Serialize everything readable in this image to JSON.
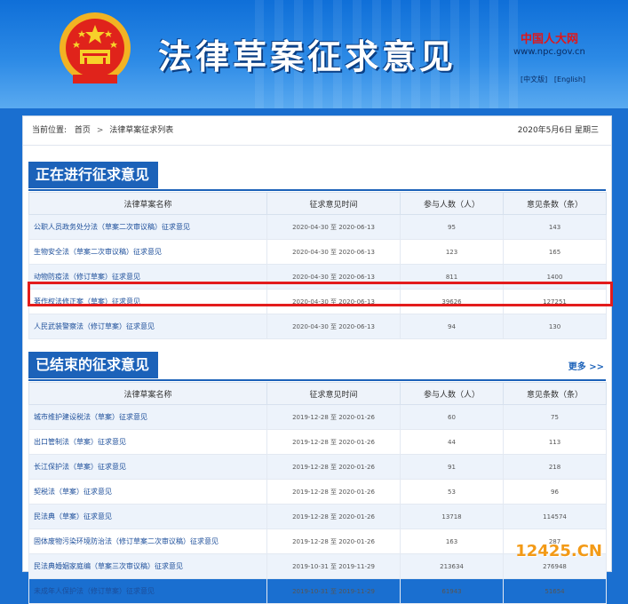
{
  "header": {
    "title": "法律草案征求意见",
    "npc_cn": "中国人大网",
    "npc_url": "www.npc.gov.cn",
    "lang_cn": "[中文版]",
    "lang_en": "[English]",
    "emblem_icon": "national-emblem-icon"
  },
  "breadcrumb": {
    "prefix": "当前位置:",
    "home": "首页",
    "sep": ">",
    "current": "法律草案征求列表",
    "date": "2020年5月6日 星期三"
  },
  "ongoing": {
    "title": "正在进行征求意见",
    "columns": [
      "法律草案名称",
      "征求意见时间",
      "参与人数（人）",
      "意见条数（条）"
    ],
    "rows": [
      {
        "name": "公职人员政务处分法（草案二次审议稿）征求意见",
        "time": "2020-04-30 至 2020-06-13",
        "people": "95",
        "opinions": "143"
      },
      {
        "name": "生物安全法（草案二次审议稿）征求意见",
        "time": "2020-04-30 至 2020-06-13",
        "people": "123",
        "opinions": "165"
      },
      {
        "name": "动物防疫法（修订草案）征求意见",
        "time": "2020-04-30 至 2020-06-13",
        "people": "811",
        "opinions": "1400"
      },
      {
        "name": "著作权法修正案（草案）征求意见",
        "time": "2020-04-30 至 2020-06-13",
        "people": "39626",
        "opinions": "127251"
      },
      {
        "name": "人民武装警察法（修订草案）征求意见",
        "time": "2020-04-30 至 2020-06-13",
        "people": "94",
        "opinions": "130"
      }
    ]
  },
  "ended": {
    "title": "已结束的征求意见",
    "more": "更多 >>",
    "columns": [
      "法律草案名称",
      "征求意见时间",
      "参与人数（人）",
      "意见条数（条）"
    ],
    "rows": [
      {
        "name": "城市维护建设税法（草案）征求意见",
        "time": "2019-12-28 至 2020-01-26",
        "people": "60",
        "opinions": "75"
      },
      {
        "name": "出口管制法（草案）征求意见",
        "time": "2019-12-28 至 2020-01-26",
        "people": "44",
        "opinions": "113"
      },
      {
        "name": "长江保护法（草案）征求意见",
        "time": "2019-12-28 至 2020-01-26",
        "people": "91",
        "opinions": "218"
      },
      {
        "name": "契税法（草案）征求意见",
        "time": "2019-12-28 至 2020-01-26",
        "people": "53",
        "opinions": "96"
      },
      {
        "name": "民法典（草案）征求意见",
        "time": "2019-12-28 至 2020-01-26",
        "people": "13718",
        "opinions": "114574"
      },
      {
        "name": "固体废物污染环境防治法（修订草案二次审议稿）征求意见",
        "time": "2019-12-28 至 2020-01-26",
        "people": "163",
        "opinions": "287"
      },
      {
        "name": "民法典婚姻家庭编（草案三次审议稿）征求意见",
        "time": "2019-10-31 至 2019-11-29",
        "people": "213634",
        "opinions": "276948"
      },
      {
        "name": "未成年人保护法（修订草案）征求意见",
        "time": "2019-10-31 至 2019-11-29",
        "people": "61943",
        "opinions": "51654"
      }
    ]
  },
  "watermark": "12425.CN",
  "colors": {
    "brand_blue": "#1c62b9",
    "highlight_red": "#e31c1c"
  }
}
